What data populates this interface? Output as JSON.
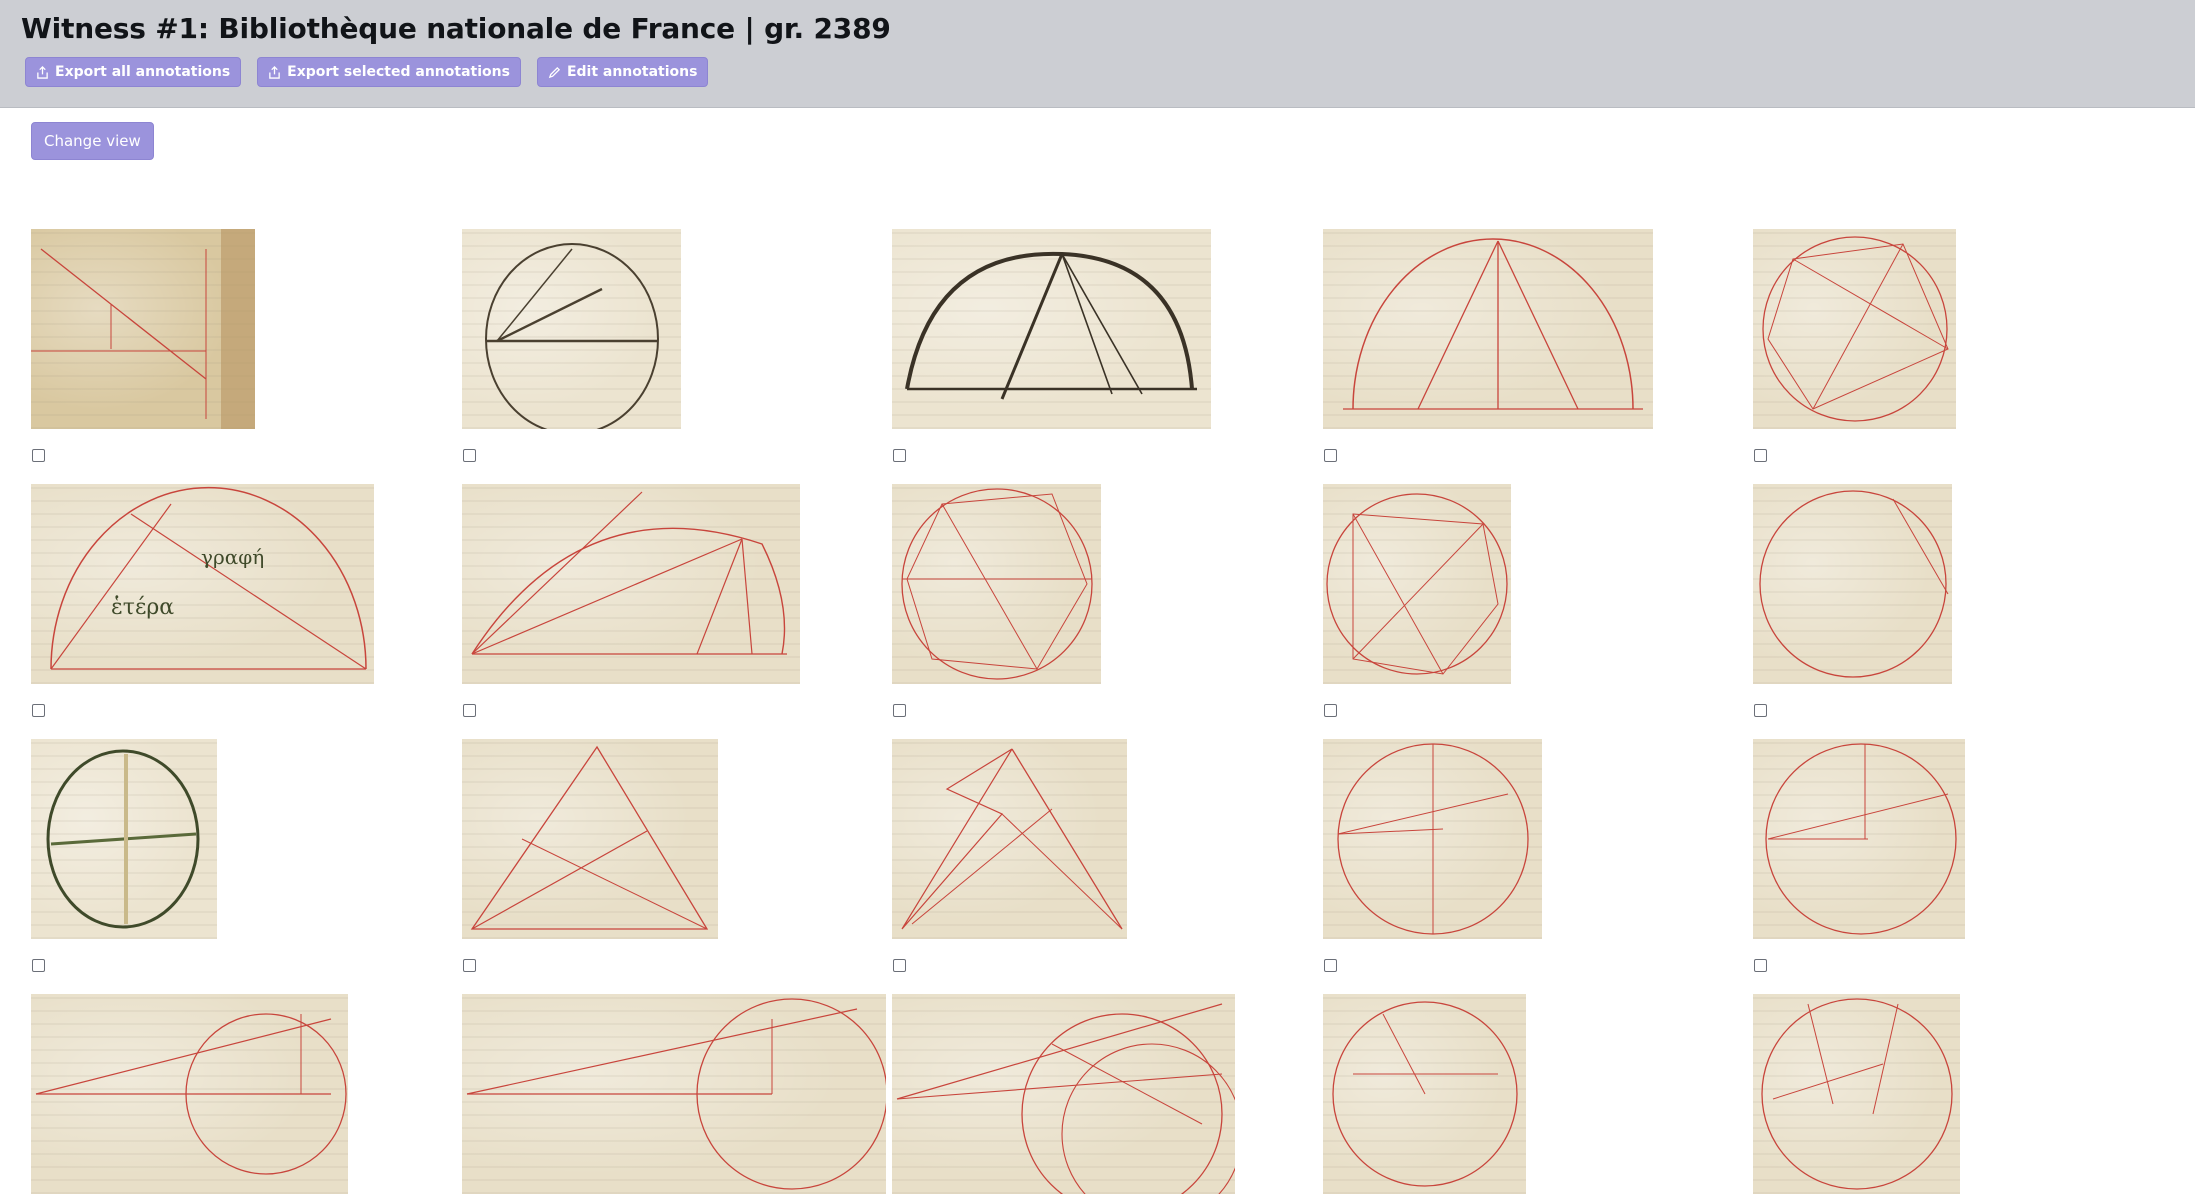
{
  "header": {
    "title": "Witness #1: Bibliothèque nationale de France | gr. 2389",
    "export_all_label": "Export all annotations",
    "export_selected_label": "Export selected annotations",
    "edit_label": "Edit annotations"
  },
  "view": {
    "change_view_label": "Change view"
  },
  "gallery": {
    "rows": [
      {
        "items": [
          {
            "kind": "triangle-corner"
          },
          {
            "kind": "ink-circle"
          },
          {
            "kind": "ink-dome"
          },
          {
            "kind": "red-semicircle"
          },
          {
            "kind": "red-circle-star"
          }
        ]
      },
      {
        "items": [
          {
            "kind": "red-semicircle-notes"
          },
          {
            "kind": "red-semicircle-chords"
          },
          {
            "kind": "red-circle-hex"
          },
          {
            "kind": "red-circle-square"
          },
          {
            "kind": "red-circle-plain"
          }
        ]
      },
      {
        "items": [
          {
            "kind": "ink-oval"
          },
          {
            "kind": "red-triangle"
          },
          {
            "kind": "red-triangle-text"
          },
          {
            "kind": "red-circle-diameter"
          },
          {
            "kind": "red-circle-radii"
          }
        ]
      },
      {
        "items": [
          {
            "kind": "red-wedge"
          },
          {
            "kind": "red-wedge-circle"
          },
          {
            "kind": "red-circles-lines"
          },
          {
            "kind": "red-circle-partial"
          },
          {
            "kind": "red-circle-partial-2"
          }
        ]
      }
    ]
  },
  "icons": {
    "export": "share-icon",
    "edit": "pencil-icon",
    "checkbox": "checkbox-icon"
  },
  "colors": {
    "header_bg": "#ccced3",
    "button_bg": "#9b93dc",
    "ink_red": "#c8453c",
    "ink_dark": "#3a3226"
  }
}
